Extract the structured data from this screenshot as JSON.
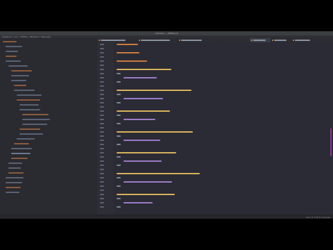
{
  "window": {
    "title": "controller — PHPStorm",
    "navbar": "phpstorm  >  src  >  Entity  >  Module  >  Step.php"
  },
  "tabs": [
    {
      "label": "Module.php",
      "active": false
    },
    {
      "label": "StepController.php",
      "active": false
    },
    {
      "label": "Step.php",
      "active": true
    },
    {
      "label": "StepRepository.php",
      "active": false
    },
    {
      "label": "services.yaml",
      "active": false
    },
    {
      "label": "Module2.php",
      "active": false
    }
  ],
  "editor": {
    "visible_code": [
      "private $step;",
      "",
      "@var StepEntity",
      "",
      "protected $textStep;",
      "",
      "public function getTitleId(): string",
      "{",
      "return $this->TitleId;",
      "}",
      "",
      "public function setTitleId(string $TitleId): void",
      "{",
      "$this->TitleId = $TitleId;",
      "}",
      "",
      "public function getStepId(): string",
      "{",
      "return $this->stepId;",
      "}",
      "",
      "public function setTheStepId(string $stepId): void",
      "{",
      "$this->stepId = $stepId;",
      "}",
      "",
      "public function getNextStepId(): string",
      "{",
      "return $this->nextStepId;",
      "}",
      "",
      "public function setNextStepId(string $nextStepId): void",
      "{",
      "$this->nextStepId = $nextStepId;",
      "}",
      "",
      "public function getTitle(): StepEntity",
      "{",
      "return $this->Name;",
      "}"
    ]
  },
  "status": {
    "right": "44:1  LF  UTF-8  4 spaces"
  },
  "colors": {
    "background": "#2b2b35",
    "keyword": "#c87b3f",
    "function": "#d6b35c",
    "variable": "#9b7bc5",
    "accent": "#7f3b8a"
  }
}
